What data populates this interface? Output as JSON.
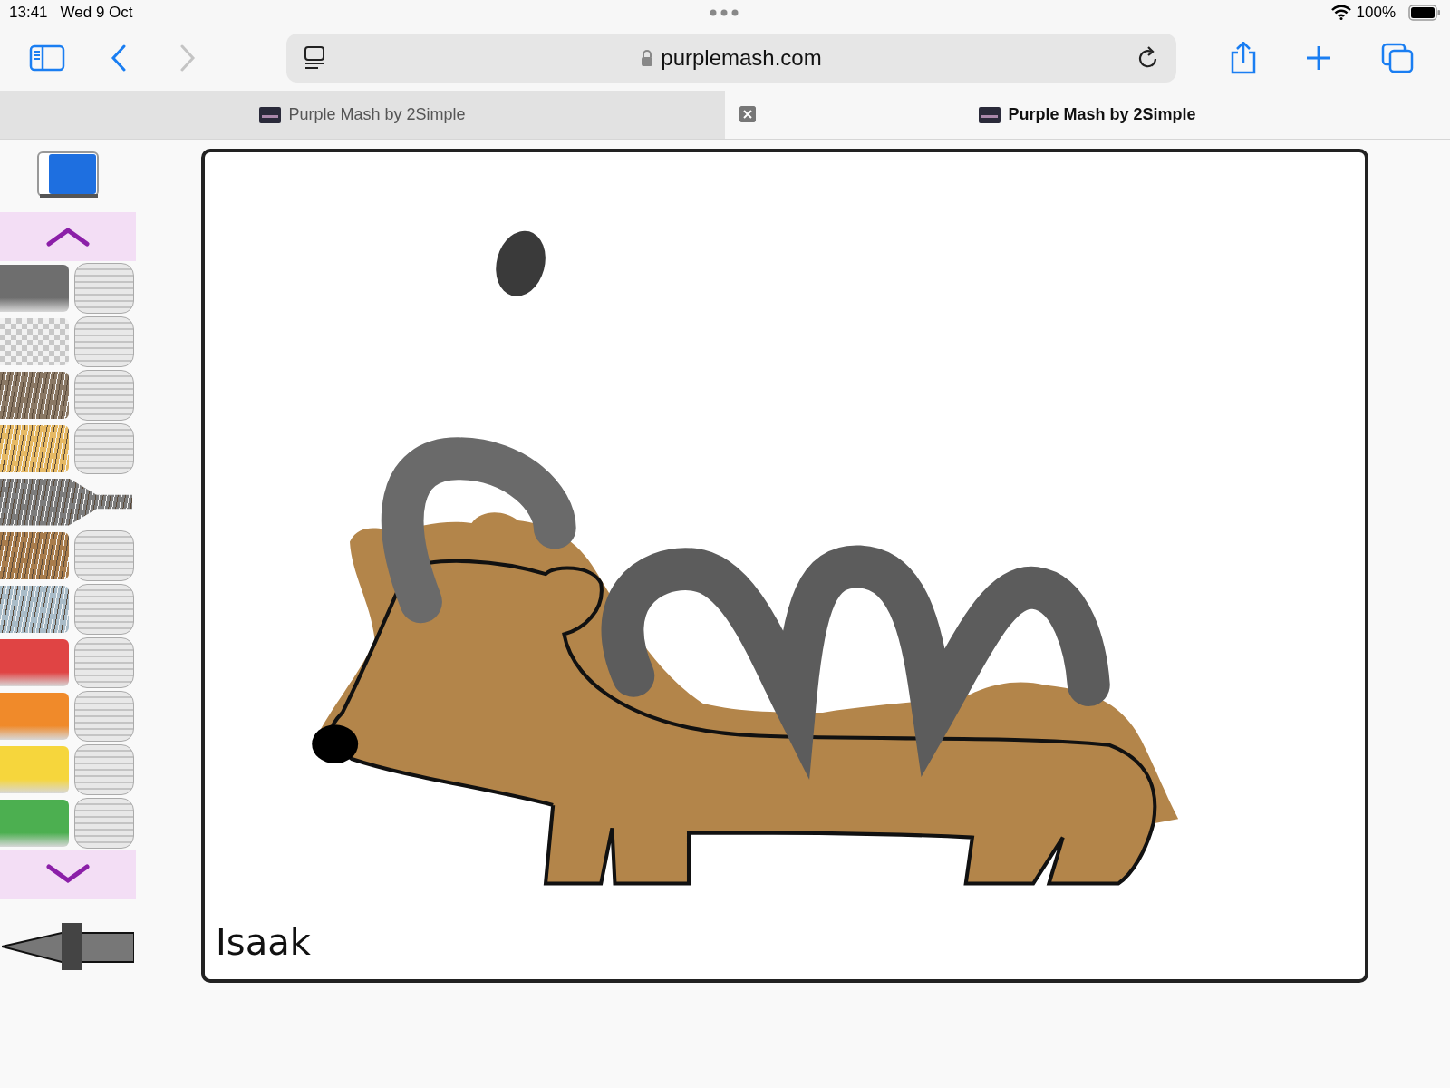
{
  "status_bar": {
    "time": "13:41",
    "date": "Wed 9 Oct",
    "battery": "100%"
  },
  "toolbar": {
    "address": "purplemash.com",
    "forward_disabled": true
  },
  "tabs": [
    {
      "title": "Purple Mash by 2Simple",
      "selected": false
    },
    {
      "title": "Purple Mash by 2Simple",
      "selected": true
    }
  ],
  "palette": {
    "pens": [
      {
        "kind": "solid",
        "color": "#6e6e6e",
        "selected": false
      },
      {
        "kind": "checker",
        "color": "#c8c8c8",
        "selected": false
      },
      {
        "kind": "fur",
        "color": "#8a7864",
        "selected": false
      },
      {
        "kind": "fur",
        "color": "#e6b964",
        "selected": false
      },
      {
        "kind": "fur",
        "color": "#7c7c7c",
        "selected": true
      },
      {
        "kind": "fur",
        "color": "#a87c4c",
        "selected": false
      },
      {
        "kind": "fur",
        "color": "#a9bcc8",
        "selected": false
      },
      {
        "kind": "solid",
        "color": "#e04444",
        "selected": false
      },
      {
        "kind": "solid",
        "color": "#f08a2a",
        "selected": false
      },
      {
        "kind": "solid",
        "color": "#f6d63c",
        "selected": false
      },
      {
        "kind": "solid",
        "color": "#4caf50",
        "selected": false
      }
    ]
  },
  "canvas": {
    "signature": "Isaak"
  }
}
